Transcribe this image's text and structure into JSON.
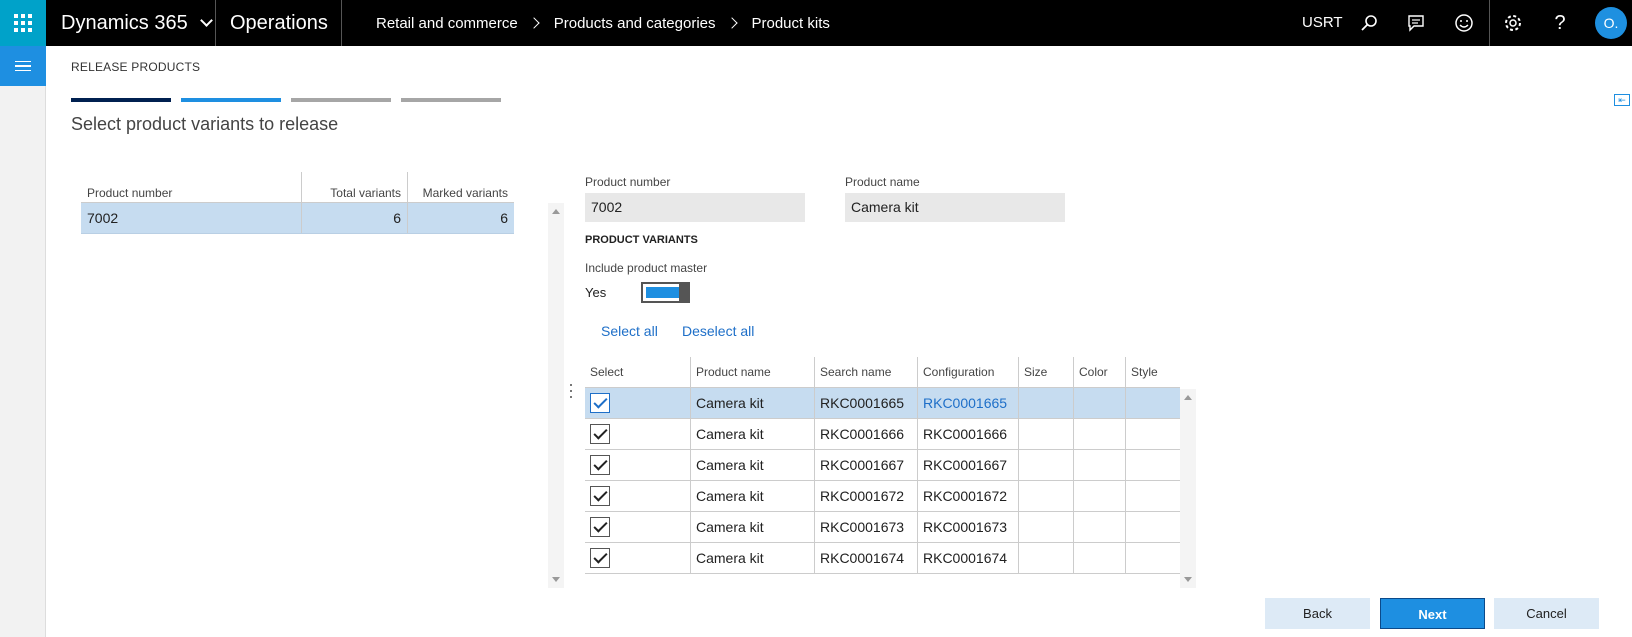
{
  "topbar": {
    "app_name": "Dynamics 365",
    "module": "Operations",
    "breadcrumb": [
      "Retail and commerce",
      "Products and categories",
      "Product kits"
    ],
    "company": "USRT",
    "avatar_initials": "O.",
    "icons": [
      "waffle-icon",
      "search-icon",
      "chat-icon",
      "smiley-icon",
      "gear-icon",
      "help-icon"
    ]
  },
  "page": {
    "section_title": "RELEASE PRODUCTS",
    "title": "Select product variants to release",
    "steps": [
      {
        "state": "done",
        "color": "#002050"
      },
      {
        "state": "active",
        "color": "#1e8fe1"
      },
      {
        "state": "todo",
        "color": "#a6a6a6"
      },
      {
        "state": "todo",
        "color": "#a6a6a6"
      }
    ]
  },
  "products_grid": {
    "headers": [
      "Product number",
      "Total variants",
      "Marked variants"
    ],
    "rows": [
      {
        "product_number": "7002",
        "total_variants": "6",
        "marked_variants": "6"
      }
    ]
  },
  "details": {
    "product_number_label": "Product number",
    "product_number": "7002",
    "product_name_label": "Product name",
    "product_name": "Camera kit",
    "variants_heading": "PRODUCT VARIANTS",
    "include_master_label": "Include product master",
    "include_master_value": "Yes",
    "select_all": "Select all",
    "deselect_all": "Deselect all"
  },
  "variants_grid": {
    "headers": [
      "Select",
      "Product name",
      "Search name",
      "Configuration",
      "Size",
      "Color",
      "Style"
    ],
    "rows": [
      {
        "product_name": "Camera kit",
        "search_name": "RKC0001665",
        "configuration": "RKC0001665",
        "size": "",
        "color": "",
        "style": ""
      },
      {
        "product_name": "Camera kit",
        "search_name": "RKC0001666",
        "configuration": "RKC0001666",
        "size": "",
        "color": "",
        "style": ""
      },
      {
        "product_name": "Camera kit",
        "search_name": "RKC0001667",
        "configuration": "RKC0001667",
        "size": "",
        "color": "",
        "style": ""
      },
      {
        "product_name": "Camera kit",
        "search_name": "RKC0001672",
        "configuration": "RKC0001672",
        "size": "",
        "color": "",
        "style": ""
      },
      {
        "product_name": "Camera kit",
        "search_name": "RKC0001673",
        "configuration": "RKC0001673",
        "size": "",
        "color": "",
        "style": ""
      },
      {
        "product_name": "Camera kit",
        "search_name": "RKC0001674",
        "configuration": "RKC0001674",
        "size": "",
        "color": "",
        "style": ""
      }
    ]
  },
  "footer": {
    "back": "Back",
    "next": "Next",
    "cancel": "Cancel"
  },
  "colors": {
    "accent": "#1e8fe1",
    "waffle": "#00a2c9",
    "selected_row": "#c6dcf0"
  }
}
